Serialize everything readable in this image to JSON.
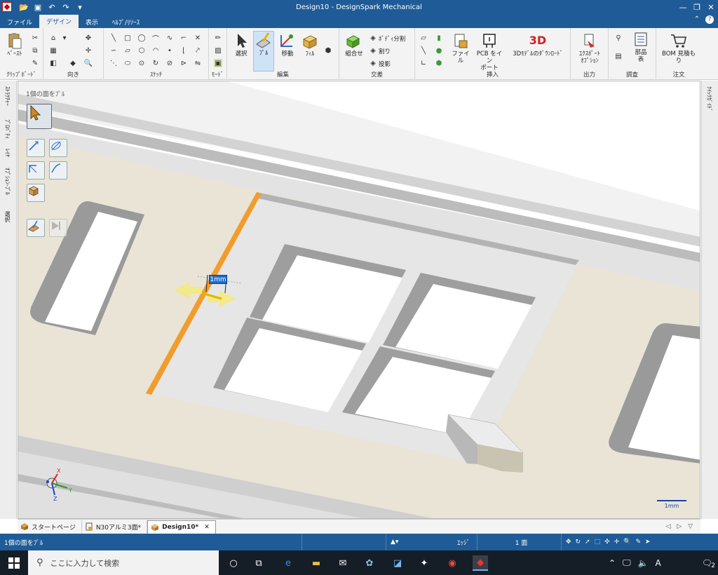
{
  "window": {
    "title": "Design10 - DesignSpark Mechanical",
    "controls": {
      "minimize": "—",
      "restore": "❐",
      "close": "✕"
    }
  },
  "menu": {
    "tabs": [
      "ファイル",
      "デザイン",
      "表示",
      "ﾍﾙﾌﾟ/ﾘｿｰｽ"
    ],
    "active_tab": "デザイン",
    "right_icons": {
      "caret": "⌃",
      "help": "?"
    }
  },
  "ribbon": {
    "clipboard": {
      "label": "ｸﾘｯﾌﾟﾎﾞｰﾄﾞ",
      "paste": "ﾍﾟｰｽﾄ"
    },
    "orient": {
      "label": "向き"
    },
    "sketch": {
      "label": "ｽｹｯﾁ"
    },
    "mode": {
      "label": "ﾓｰﾄﾞ"
    },
    "edit": {
      "label": "編集",
      "select": "選択",
      "pull": "ﾌﾟﾙ",
      "move": "移動",
      "fill": "ﾌｨﾙ"
    },
    "intersect": {
      "label": "交差",
      "combine": "組合せ",
      "split_body": "ﾎﾞﾃﾞｨ分割",
      "split": "割り",
      "project": "投影"
    },
    "insert": {
      "label": "挿入",
      "file": "ファイル",
      "pcb_import": "PCB をイン\nポート",
      "model_3d_text": "3D",
      "model_3d": "3Dﾓﾃﾞﾙのﾀﾞｳﾝﾛｰﾄﾞ"
    },
    "output": {
      "label": "出力",
      "export": "ｴｸｽﾎﾟｰﾄ\nｵﾌﾟｼｮﾝ"
    },
    "investigate": {
      "label": "調査",
      "parts": "部品\n表"
    },
    "order": {
      "label": "注文",
      "bom": "BOM 見積も\nり"
    }
  },
  "left_panel": {
    "tabs": [
      "ｽﾄﾗｸﾁｬｰ",
      "ﾌﾟﾛﾊﾟﾃｨ",
      "ﾚｲﾔ",
      "ｵﾌﾟｼｮﾝ-ﾌﾟﾙ",
      "選択"
    ]
  },
  "right_panel": {
    "tabs": [
      "ｸｲｯｸｶﾞｲﾄﾞ"
    ]
  },
  "viewport": {
    "hint": "1個の面をﾌﾟﾙ",
    "dimension_value": "1mm",
    "scale_label": "1mm",
    "axes": {
      "x": "X",
      "y": "Y",
      "z": "Z"
    }
  },
  "doc_tabs": [
    {
      "label": "スタートページ",
      "active": false,
      "closable": false
    },
    {
      "label": "N30アルミ3面*",
      "active": false,
      "closable": false
    },
    {
      "label": "Design10*",
      "active": true,
      "closable": true
    }
  ],
  "doc_tabs_nav": "◁ ▷ ▽",
  "status": {
    "message": "1個の面をﾌﾟﾙ",
    "filter": "ｴｯｼﾞ",
    "selection": "1 面"
  },
  "taskbar": {
    "search_placeholder": "ここに入力して検索",
    "tray_ime": "A",
    "notification_count": "2"
  },
  "colors": {
    "title_bar": "#1f5c97",
    "highlight_edge": "#f19c2c",
    "dimension_box": "#1e6fd0",
    "taskbar": "#151d27"
  }
}
